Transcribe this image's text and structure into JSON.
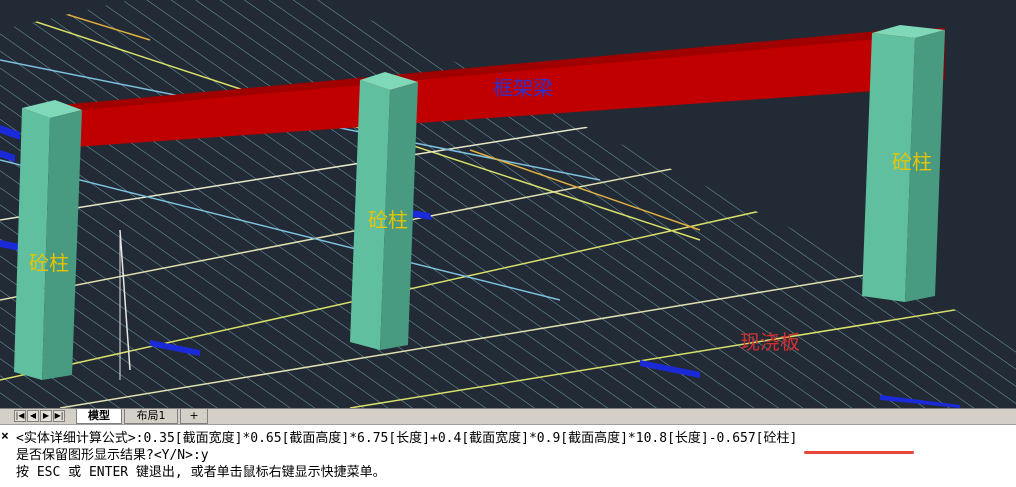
{
  "viewport": {
    "labels": {
      "beam": "框架梁",
      "column_left": "砼柱",
      "column_middle": "砼柱",
      "column_right": "砼柱",
      "slab": "现浇板"
    },
    "colors": {
      "background": "#222a35",
      "beam": "#c00000",
      "column": "#5fbf9f",
      "hatch": "#8fc8d0",
      "beam_label": "#3030c8",
      "column_label": "#e8c400",
      "slab_label": "#d03030"
    }
  },
  "tabs": {
    "nav": [
      "|◀",
      "◀",
      "▶",
      "▶|"
    ],
    "model": "模型",
    "layout1": "布局1",
    "add": "+"
  },
  "command": {
    "close": "×",
    "line1": "<实体详细计算公式>:0.35[截面宽度]*0.65[截面高度]*6.75[长度]+0.4[截面宽度]*0.9[截面高度]*10.8[长度]-0.657[砼柱]",
    "line2": "是否保留图形显示结果?<Y/N>:y",
    "line3": "按 ESC 或 ENTER 键退出, 或者单击鼠标右键显示快捷菜单。"
  }
}
